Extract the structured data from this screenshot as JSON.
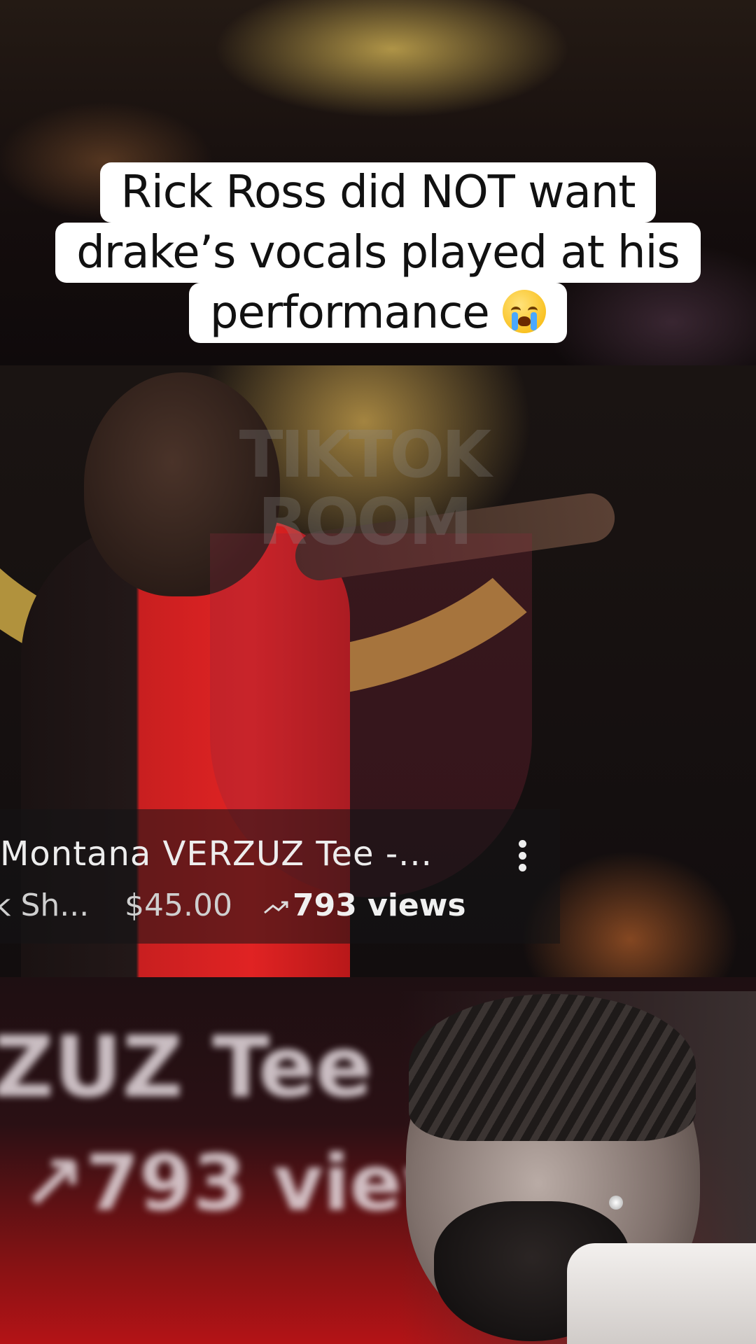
{
  "caption": {
    "lines": [
      "Rick Ross did NOT want",
      "drake’s vocals played at his",
      "performance"
    ],
    "emoji_icon": "loudly-crying-face-icon"
  },
  "product_banner": {
    "title": "Montana VERZUZ Tee -...",
    "seller": "k Sh...",
    "price": "$45.00",
    "views": "793 views",
    "trend_icon": "trending-arrow-icon",
    "menu_icon": "more-vertical-icon"
  },
  "watermark": {
    "text": "TIKTOK ROOM",
    "icon": "tiktok-logo-icon"
  },
  "bottom_blur": {
    "line1": "ZUZ Tee",
    "line2": "↗793 view"
  },
  "colors": {
    "caption_bg": "#ffffff",
    "caption_text": "#111111",
    "shirt_red": "#e02323",
    "gold": "#cdaa46"
  }
}
